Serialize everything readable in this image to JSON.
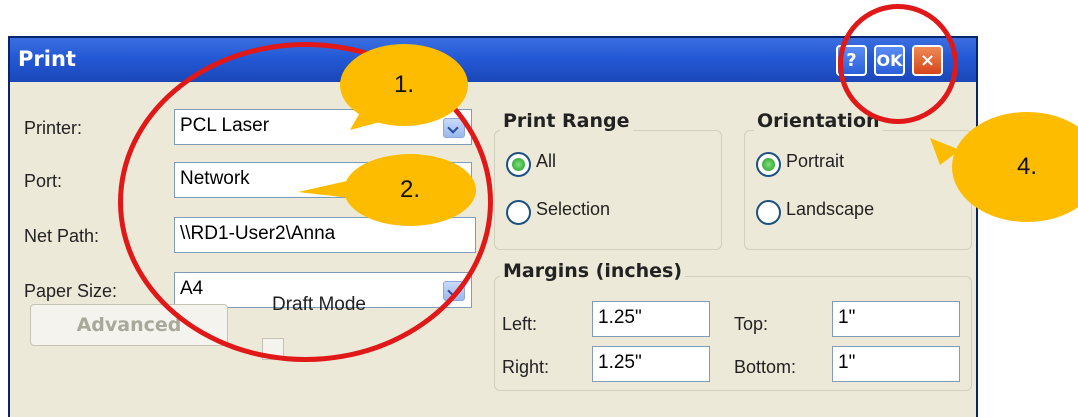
{
  "window": {
    "title": "Print"
  },
  "titlebar": {
    "help_label": "?",
    "ok_label": "OK",
    "close_label": "×"
  },
  "printer": {
    "label": "Printer:",
    "value": "PCL Laser"
  },
  "port": {
    "label": "Port:",
    "value": "Network"
  },
  "net_path": {
    "label": "Net Path:",
    "value": "\\\\RD1-User2\\Anna"
  },
  "paper_size": {
    "label": "Paper Size:",
    "value": "A4"
  },
  "advanced": {
    "label": "Advanced"
  },
  "draft_mode": {
    "label": "Draft Mode"
  },
  "print_range": {
    "title": "Print Range",
    "options": [
      {
        "label": "All",
        "selected": true
      },
      {
        "label": "Selection",
        "selected": false
      }
    ]
  },
  "orientation": {
    "title": "Orientation",
    "options": [
      {
        "label": "Portrait",
        "selected": true
      },
      {
        "label": "Landscape",
        "selected": false
      }
    ]
  },
  "margins": {
    "title": "Margins (inches)",
    "left_label": "Left:",
    "left_value": "1.25\"",
    "top_label": "Top:",
    "top_value": "1\"",
    "right_label": "Right:",
    "right_value": "1.25\"",
    "bottom_label": "Bottom:",
    "bottom_value": "1\""
  },
  "annotations": {
    "callout_1": "1.",
    "callout_2": "2.",
    "callout_4": "4."
  },
  "colors": {
    "callout": "#fdbc00",
    "highlight": "#e01818",
    "title_bar": "#2459d6"
  }
}
